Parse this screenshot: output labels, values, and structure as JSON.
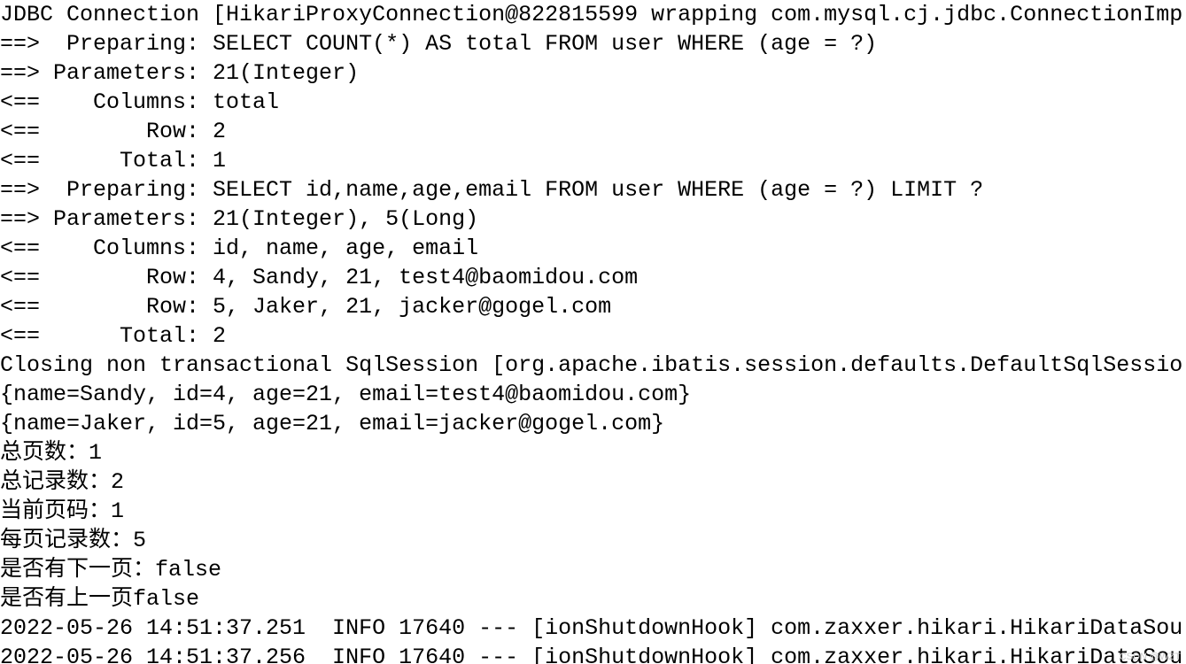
{
  "console": {
    "lines": [
      "JDBC Connection [HikariProxyConnection@822815599 wrapping com.mysql.cj.jdbc.ConnectionImp",
      "==>  Preparing: SELECT COUNT(*) AS total FROM user WHERE (age = ?)",
      "==> Parameters: 21(Integer)",
      "<==    Columns: total",
      "<==        Row: 2",
      "<==      Total: 1",
      "==>  Preparing: SELECT id,name,age,email FROM user WHERE (age = ?) LIMIT ?",
      "==> Parameters: 21(Integer), 5(Long)",
      "<==    Columns: id, name, age, email",
      "<==        Row: 4, Sandy, 21, test4@baomidou.com",
      "<==        Row: 5, Jaker, 21, jacker@gogel.com",
      "<==      Total: 2",
      "Closing non transactional SqlSession [org.apache.ibatis.session.defaults.DefaultSqlSessio",
      "{name=Sandy, id=4, age=21, email=test4@baomidou.com}",
      "{name=Jaker, id=5, age=21, email=jacker@gogel.com}",
      "总页数：1",
      "总记录数：2",
      "当前页码：1",
      "每页记录数：5",
      "是否有下一页：false",
      "是否有上一页false",
      "2022-05-26 14:51:37.251  INFO 17640 --- [ionShutdownHook] com.zaxxer.hikari.HikariDataSou",
      "2022-05-26 14:51:37.256  INFO 17640 --- [ionShutdownHook] com.zaxxer.hikari.HikariDataSou"
    ]
  },
  "watermark": "CSDN @WZT"
}
